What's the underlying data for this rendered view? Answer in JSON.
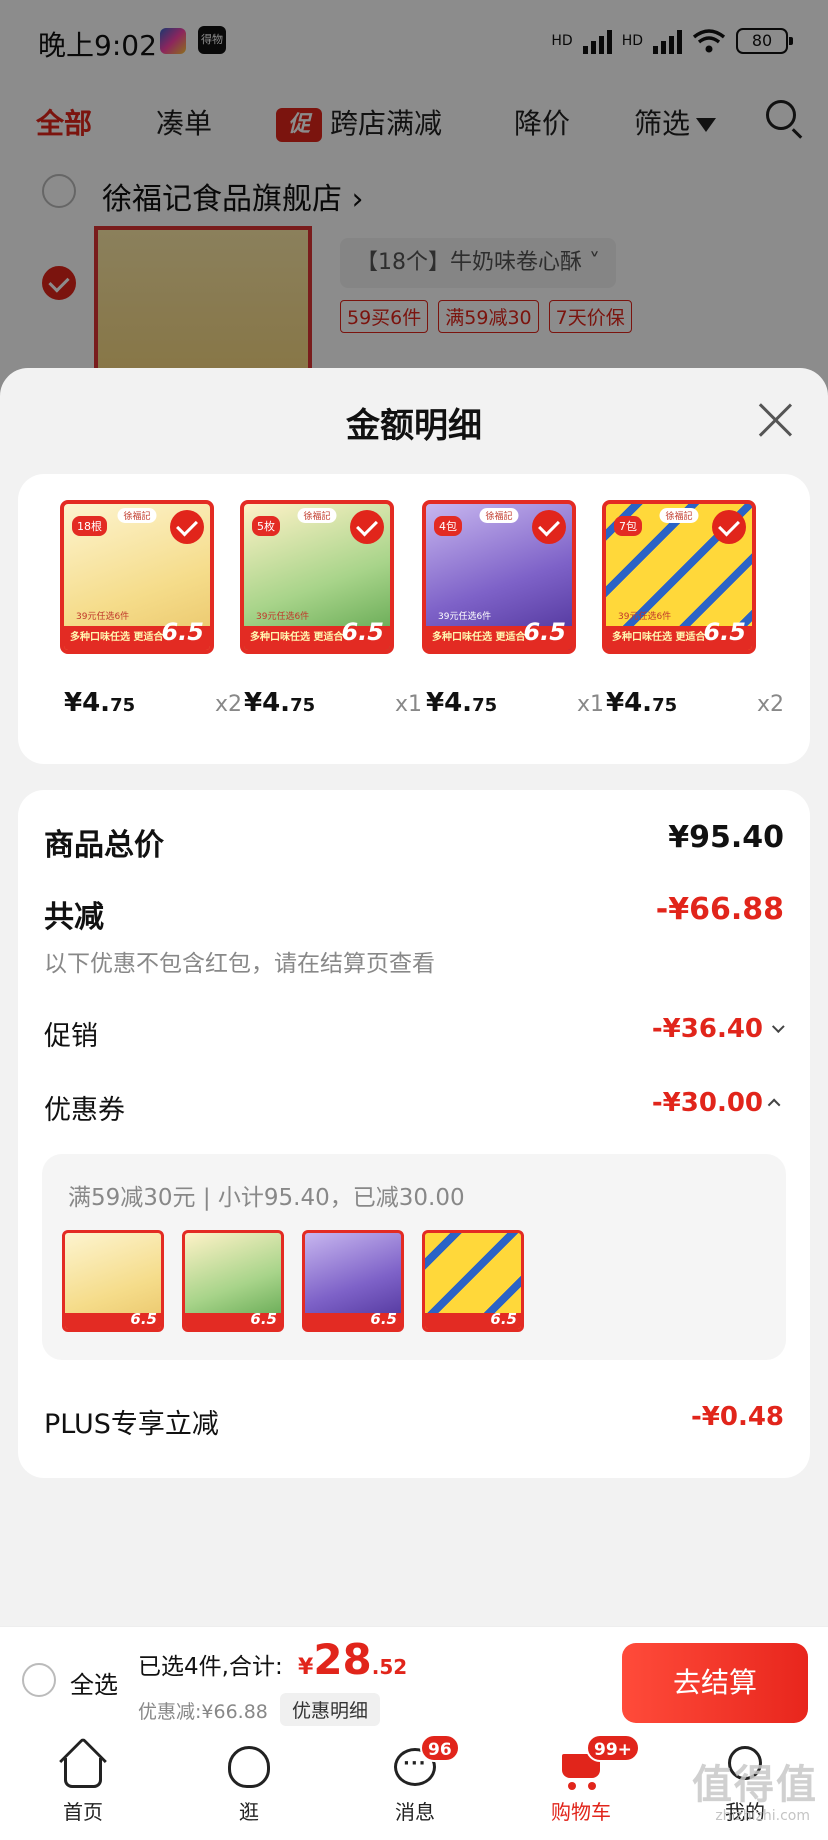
{
  "status_bar": {
    "time": "晚上9:02",
    "battery": "80",
    "hd": "HD"
  },
  "top_tabs": {
    "all": "全部",
    "bundle": "凑单",
    "promo_tag": "促",
    "cross_store": "跨店满减",
    "price_drop": "降价",
    "filter": "筛选"
  },
  "background_store": {
    "shop_name": "徐福记食品旗舰店 ›",
    "variant": "【18个】牛奶味卷心酥 ˅",
    "tags": [
      "59买6件",
      "满59减30",
      "7天价保"
    ]
  },
  "sheet": {
    "title": "金额明细",
    "items": [
      {
        "price_int": "¥4.",
        "price_dec": "75",
        "qty": "x2",
        "tag": "18根",
        "band": "多种口味任选 更适合",
        "price_badge": "6.5",
        "logo": "徐福記",
        "promo": "39元任选6件"
      },
      {
        "price_int": "¥4.",
        "price_dec": "75",
        "qty": "x1",
        "tag": "5枚",
        "band": "多种口味任选 更适合",
        "price_badge": "6.5",
        "logo": "徐福記",
        "promo": "39元任选6件"
      },
      {
        "price_int": "¥4.",
        "price_dec": "75",
        "qty": "x1",
        "tag": "4包",
        "band": "多种口味任选 更适合",
        "price_badge": "6.5",
        "logo": "徐福記",
        "promo": "39元任选6件"
      },
      {
        "price_int": "¥4.",
        "price_dec": "75",
        "qty": "x2",
        "tag": "7包",
        "band": "多种口味任选 更适合",
        "price_badge": "6.5",
        "logo": "徐福記",
        "promo": "39元任选6件"
      }
    ],
    "summary": {
      "total_label": "商品总价",
      "total_value": "¥95.40",
      "reduce_label": "共减",
      "reduce_value": "-¥66.88",
      "note": "以下优惠不包含红包，请在结算页查看",
      "promo_label": "促销",
      "promo_value": "-¥36.40",
      "coupon_label": "优惠券",
      "coupon_value": "-¥30.00",
      "coupon_desc": "满59减30元 | 小计95.40，已减30.00",
      "coupon_thumbs": [
        "6.5",
        "6.5",
        "6.5",
        "6.5"
      ],
      "plus_label": "PLUS专享立减",
      "plus_value": "-¥0.48"
    }
  },
  "checkout": {
    "select_all": "全选",
    "selected_summary": "已选4件,合计:",
    "price_symbol": "¥",
    "price_int": "28",
    "price_dec": ".52",
    "discount": "优惠减:¥66.88",
    "detail_chip": "优惠明细",
    "button": "去结算"
  },
  "tab_bar": {
    "home": "首页",
    "browse": "逛",
    "messages": "消息",
    "messages_badge": "96",
    "cart": "购物车",
    "cart_badge": "99+",
    "me": "我的"
  },
  "watermark": {
    "main": "值得值",
    "sub": "zhizhizhi.com"
  },
  "colors": {
    "accent": "#e1251b",
    "sheet_bg": "#f2f2f2"
  }
}
